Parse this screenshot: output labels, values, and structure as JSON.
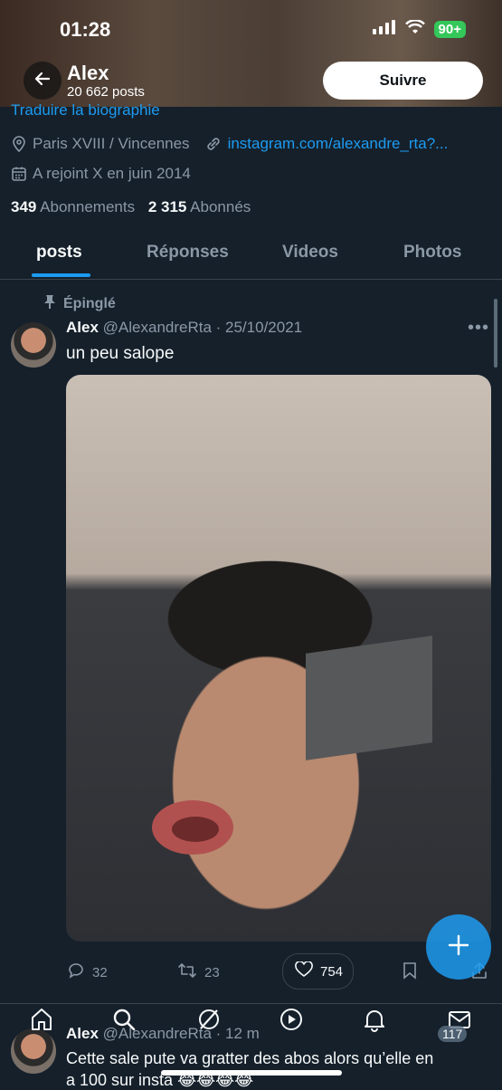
{
  "status_bar": {
    "time": "01:28",
    "battery": "90+"
  },
  "header": {
    "name": "Alex",
    "posts_count": "20 662 posts",
    "follow_label": "Suivre"
  },
  "profile": {
    "translate_bio": "Traduire la biographie",
    "location": "Paris XVIII / Vincennes",
    "website": "instagram.com/alexandre_rta?...",
    "joined": "A rejoint X en juin 2014",
    "following_count": "349",
    "following_label": "Abonnements",
    "followers_count": "2 315",
    "followers_label": "Abonnés"
  },
  "tabs": [
    {
      "label": "posts",
      "active": true
    },
    {
      "label": "Réponses",
      "active": false
    },
    {
      "label": "Videos",
      "active": false
    },
    {
      "label": "Photos",
      "active": false
    }
  ],
  "pinned_post": {
    "pinned_label": "Épinglé",
    "author": "Alex",
    "handle_date": "@AlexandreRta · 25/10/2021",
    "text": "un peu salope",
    "replies": "32",
    "reposts": "23",
    "likes": "754"
  },
  "second_post": {
    "author": "Alex",
    "handle_date": "@AlexandreRta · 12 m",
    "text_line1": "Cette sale pute va gratter des abos alors qu’elle en",
    "text_line2": "a 100 sur insta 😂😂😂😂",
    "reply_badge": "117"
  },
  "colors": {
    "accent": "#1d9bf0",
    "background": "#15202b",
    "muted": "#8b98a5"
  },
  "icons": [
    "back-arrow-icon",
    "location-icon",
    "link-icon",
    "calendar-icon",
    "pin-icon",
    "reply-icon",
    "repost-icon",
    "heart-icon",
    "bookmark-icon",
    "share-icon",
    "plus-icon",
    "home-icon",
    "search-icon",
    "grok-icon",
    "play-icon",
    "bell-icon",
    "mail-icon"
  ]
}
